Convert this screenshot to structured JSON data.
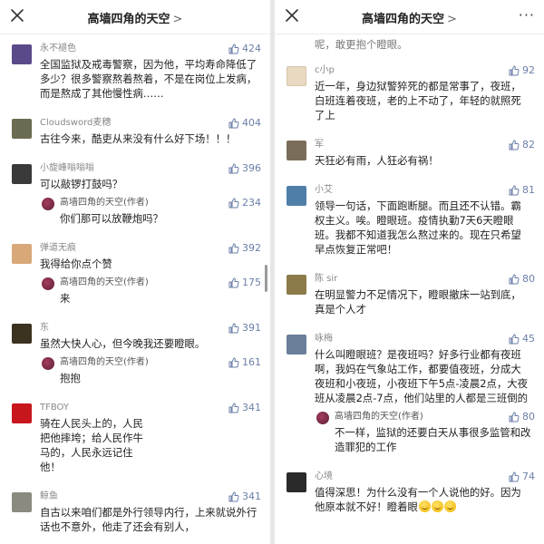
{
  "left": {
    "header": {
      "title": "高墙四角的天空",
      "chevron": ">",
      "close_icon": "close-icon",
      "more_label": "···"
    },
    "comments": [
      {
        "user": "永不褪色",
        "likes": "424",
        "text": "全国监狱及戒毒警察，因为他，平均寿命降低了多少？很多警察熬着熬着，不是在岗位上发病，而是熬成了其他慢性病……",
        "avatar_color": "#5b4a8a"
      },
      {
        "user": "Cloudsword麦穗",
        "likes": "404",
        "text": "古往今来，酷吏从来没有什么好下场！！！",
        "avatar_color": "#6b6b52"
      },
      {
        "user": "小旋峰嗡嗡嗡",
        "likes": "396",
        "text": "可以敲锣打鼓吗？",
        "avatar_color": "#3a3a3a",
        "reply": {
          "user": "高墙四角的天空(作者)",
          "likes": "234",
          "text": "你们那可以放鞭炮吗？"
        }
      },
      {
        "user": "弹道无痕",
        "likes": "392",
        "text": "我得给你点个赞",
        "avatar_color": "#d9a878",
        "reply": {
          "user": "高墙四角的天空(作者)",
          "likes": "175",
          "text": "来"
        }
      },
      {
        "user": "东",
        "likes": "391",
        "text": "虽然大快人心，但今晚我还要瞪眼。",
        "avatar_color": "#3b3320",
        "reply": {
          "user": "高墙四角的天空(作者)",
          "likes": "161",
          "text": "抱抱"
        }
      },
      {
        "user": "TFBOY",
        "likes": "341",
        "text": "骑在人民头上的，人民把他摔垮；给人民作牛马的，人民永远记住他！",
        "avatar_color": "#c8161d"
      },
      {
        "user": "鲸鱼",
        "likes": "341",
        "text": "自古以来咱们都是外行领导内行，上来就说外行话也不意外，他走了还会有别人，",
        "avatar_color": "#8a8a80"
      }
    ]
  },
  "right": {
    "header": {
      "title": "高墙四角的天空",
      "chevron": ">",
      "close_icon": "close-icon",
      "more_label": "···"
    },
    "partial_top_text": "呢，敢更抱个瞪眼。",
    "comments": [
      {
        "user": "c小p",
        "likes": "92",
        "text": "近一年，身边狱警猝死的都是常事了，夜班，白班连着夜班，老的上不动了，年轻的就照死了上",
        "avatar_color": "#e8d9c0"
      },
      {
        "user": "军",
        "likes": "82",
        "text": "天狂必有雨，人狂必有祸！",
        "avatar_color": "#7a6e5a"
      },
      {
        "user": "小艾",
        "likes": "81",
        "text": "领导一句话，下面跑断腿。而且还不认错。霸权主义。唉。瞪眼班。疫情执勤7天6天瞪眼班。我都不知道我怎么熬过来的。现在只希望早点恢复正常吧！",
        "avatar_color": "#4f7fa8"
      },
      {
        "user": "陈 sir",
        "likes": "80",
        "text": "在明显警力不足情况下，瞪眼撤床一站到底，真是个人才",
        "avatar_color": "#8c7a4a"
      },
      {
        "user": "咏梅",
        "likes": "45",
        "text": "什么叫瞪眼班？是夜班吗？好多行业都有夜班啊，我妈在气象站工作，都要值夜班，分成大夜班和小夜班，小夜班下午5点-凌晨2点，大夜班从凌晨2点-7点，他们站里的人都是三班倒的",
        "avatar_color": "#6a7f9a",
        "reply": {
          "user": "高墙四角的天空(作者)",
          "likes": "80",
          "text": "不一样，监狱的还要白天从事很多监管和改造罪犯的工作"
        }
      },
      {
        "user": "心境",
        "likes": "74",
        "text": "值得深思！为什么没有一个人说他的好。因为他原本就不好！瞪着眼",
        "avatar_color": "#2a2a2a"
      }
    ]
  }
}
